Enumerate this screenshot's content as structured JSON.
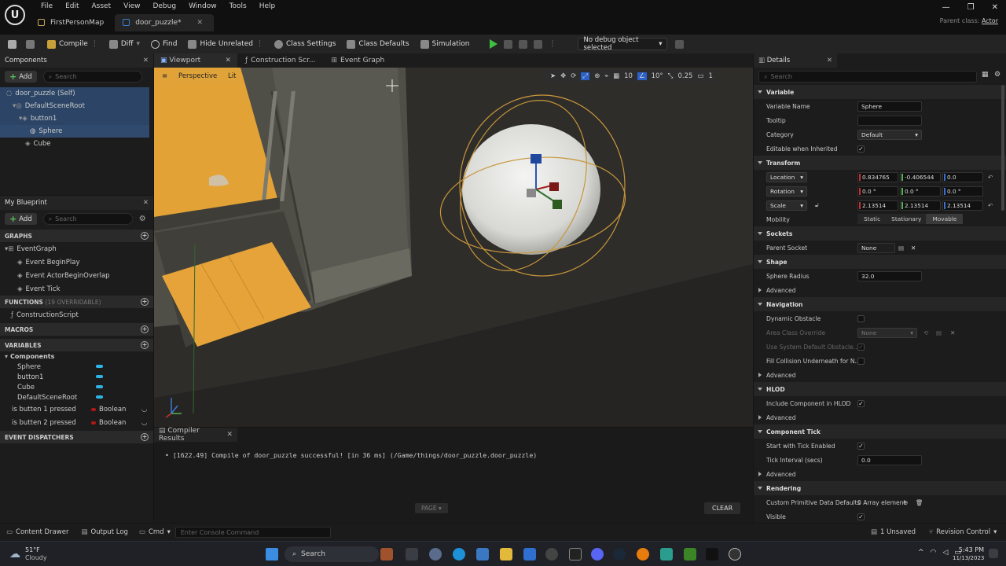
{
  "app": {
    "menu": [
      "File",
      "Edit",
      "Asset",
      "View",
      "Debug",
      "Window",
      "Tools",
      "Help"
    ],
    "tabs": [
      {
        "label": "FirstPersonMap",
        "active": false
      },
      {
        "label": "door_puzzle*",
        "active": true
      }
    ],
    "parent_class_label": "Parent class:",
    "parent_class_value": "Actor"
  },
  "toolbar": {
    "compile": "Compile",
    "diff": "Diff",
    "find": "Find",
    "hide_unrelated": "Hide Unrelated",
    "class_settings": "Class Settings",
    "class_defaults": "Class Defaults",
    "simulation": "Simulation",
    "debug_object": "No debug object selected"
  },
  "components_panel": {
    "title": "Components",
    "add": "Add",
    "search_placeholder": "Search",
    "tree": [
      "door_puzzle (Self)",
      "DefaultSceneRoot",
      "button1",
      "Sphere",
      "Cube"
    ]
  },
  "my_blueprint": {
    "title": "My Blueprint",
    "add": "Add",
    "search_placeholder": "Search",
    "graphs_header": "GRAPHS",
    "event_graph": "EventGraph",
    "events": [
      "Event BeginPlay",
      "Event ActorBeginOverlap",
      "Event Tick"
    ],
    "functions_header": "FUNCTIONS",
    "functions_note": "(19 OVERRIDABLE)",
    "construction_script": "ConstructionScript",
    "macros_header": "MACROS",
    "variables_header": "VARIABLES",
    "components_group": "Components",
    "component_vars": [
      "Sphere",
      "button1",
      "Cube",
      "DefaultSceneRoot"
    ],
    "bool_vars": [
      {
        "name": "is butten 1 pressed",
        "type": "Boolean"
      },
      {
        "name": "is butten 2 pressed",
        "type": "Boolean"
      }
    ],
    "dispatchers_header": "EVENT DISPATCHERS"
  },
  "editor_tabs": [
    "Viewport",
    "Construction Scr...",
    "Event Graph"
  ],
  "viewport": {
    "perspective": "Perspective",
    "lit": "Lit",
    "grid_snap": "10",
    "angle_snap": "10°",
    "scale_snap": "0.25",
    "camera_speed": "1"
  },
  "compiler": {
    "title": "Compiler Results",
    "message": "[1622.49] Compile of door_puzzle successful! [in 36 ms] (/Game/things/door_puzzle.door_puzzle)",
    "page": "PAGE",
    "clear": "CLEAR"
  },
  "details": {
    "title": "Details",
    "search_placeholder": "Search",
    "variable_header": "Variable",
    "variable_name_label": "Variable Name",
    "variable_name": "Sphere",
    "tooltip_label": "Tooltip",
    "category_label": "Category",
    "category": "Default",
    "editable_inherited_label": "Editable when Inherited",
    "transform_header": "Transform",
    "location_label": "Location",
    "location": [
      "0.834765",
      "-0.406544",
      "0.0"
    ],
    "rotation_label": "Rotation",
    "rotation": [
      "0.0 °",
      "0.0 °",
      "0.0 °"
    ],
    "scale_label": "Scale",
    "scale": [
      "2.13514",
      "2.13514",
      "2.13514"
    ],
    "mobility_label": "Mobility",
    "mobility_options": [
      "Static",
      "Stationary",
      "Movable"
    ],
    "sockets_header": "Sockets",
    "parent_socket_label": "Parent Socket",
    "parent_socket": "None",
    "shape_header": "Shape",
    "sphere_radius_label": "Sphere Radius",
    "sphere_radius": "32.0",
    "advanced": "Advanced",
    "navigation_header": "Navigation",
    "dynamic_obstacle_label": "Dynamic Obstacle",
    "area_class_label": "Area Class Override",
    "area_class": "None",
    "use_system_label": "Use System Default Obstacle...",
    "fill_collision_label": "Fill Collision Underneath for N...",
    "hlod_header": "HLOD",
    "include_hlod_label": "Include Component in HLOD",
    "tick_header": "Component Tick",
    "start_tick_label": "Start with Tick Enabled",
    "tick_interval_label": "Tick Interval (secs)",
    "tick_interval": "0.0",
    "rendering_header": "Rendering",
    "custom_prim_label": "Custom Primitive Data Defaults",
    "custom_prim_value": "0 Array element",
    "visible_label": "Visible"
  },
  "statusbar": {
    "content_drawer": "Content Drawer",
    "output_log": "Output Log",
    "cmd": "Cmd",
    "console_placeholder": "Enter Console Command",
    "unsaved": "1 Unsaved",
    "revision_control": "Revision Control"
  },
  "taskbar": {
    "weather_temp": "51°F",
    "weather_desc": "Cloudy",
    "search": "Search",
    "time": "5:43 PM",
    "date": "11/13/2023"
  }
}
